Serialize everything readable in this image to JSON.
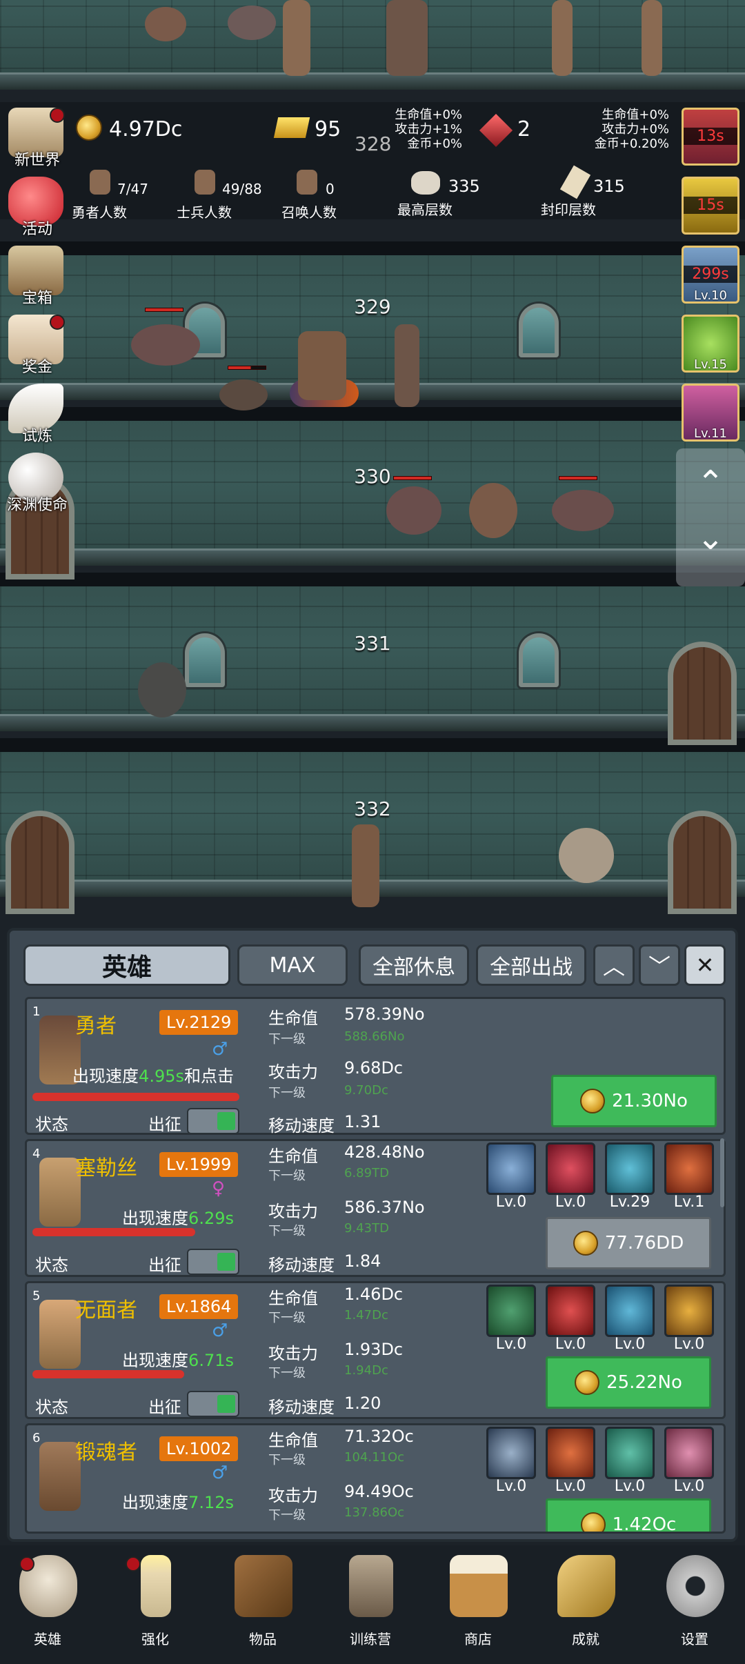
{
  "hud": {
    "gold": "4.97Dc",
    "bars": "95",
    "floor_top": "328",
    "gems": "2",
    "bonus_left": [
      "生命值+0%",
      "攻击力+1%",
      "金币+0%"
    ],
    "bonus_right": [
      "生命值+0%",
      "攻击力+0%",
      "金币+0.20%"
    ],
    "heroes_count": "7/47",
    "heroes_label": "勇者人数",
    "soldiers_count": "49/88",
    "soldiers_label": "士兵人数",
    "summon_count": "0",
    "summon_label": "召唤人数",
    "max_floor": "335",
    "max_floor_label": "最高层数",
    "seal_floor": "315",
    "seal_floor_label": "封印层数"
  },
  "left_menu": [
    "新世界",
    "活动",
    "宝箱",
    "奖金",
    "试炼",
    "深渊使命"
  ],
  "right_slots": [
    {
      "timer": "13s",
      "lv": ""
    },
    {
      "timer": "15s",
      "lv": ""
    },
    {
      "timer": "299s",
      "lv": "Lv.10"
    },
    {
      "timer": "",
      "lv": "Lv.15"
    },
    {
      "timer": "",
      "lv": "Lv.11"
    }
  ],
  "floors": [
    "329",
    "330",
    "331",
    "332"
  ],
  "arrows": {
    "up": "⌃",
    "down": "⌄"
  },
  "toolbar": {
    "heroes_tab": "英雄",
    "max_btn": "MAX",
    "rest_all": "全部休息",
    "deploy_all": "全部出战",
    "up": "︿",
    "down": "﹀",
    "close": "✕"
  },
  "labels": {
    "hp": "生命值",
    "next": "下一级",
    "atk": "攻击力",
    "move": "移动速度",
    "status": "状态",
    "deploy": "出征"
  },
  "heroes": [
    {
      "idx": "1",
      "name": "勇者",
      "lv": "Lv.2129",
      "gender": "♂",
      "speed_pre": "出现速度",
      "speed": "4.95s",
      "speed_post": "和点击",
      "hp": "578.39No",
      "hp_next": "588.66No",
      "atk": "9.68Dc",
      "atk_next": "9.70Dc",
      "move": "1.31",
      "cost": "21.30No",
      "skills": []
    },
    {
      "idx": "4",
      "name": "塞勒丝",
      "lv": "Lv.1999",
      "gender": "♀",
      "speed_pre": "出现速度",
      "speed": "6.29s",
      "speed_post": "",
      "hp": "428.48No",
      "hp_next": "6.89TD",
      "atk": "586.37No",
      "atk_next": "9.43TD",
      "move": "1.84",
      "cost": "77.76DD",
      "skills": [
        "Lv.0",
        "Lv.0",
        "Lv.29",
        "Lv.1"
      ]
    },
    {
      "idx": "5",
      "name": "无面者",
      "lv": "Lv.1864",
      "gender": "♂",
      "speed_pre": "出现速度",
      "speed": "6.71s",
      "speed_post": "",
      "hp": "1.46Dc",
      "hp_next": "1.47Dc",
      "atk": "1.93Dc",
      "atk_next": "1.94Dc",
      "move": "1.20",
      "cost": "25.22No",
      "skills": [
        "Lv.0",
        "Lv.0",
        "Lv.0",
        "Lv.0"
      ]
    },
    {
      "idx": "6",
      "name": "锻魂者",
      "lv": "Lv.1002",
      "gender": "♂",
      "speed_pre": "出现速度",
      "speed": "7.12s",
      "speed_post": "",
      "hp": "71.32Oc",
      "hp_next": "104.11Oc",
      "atk": "94.49Oc",
      "atk_next": "137.86Oc",
      "move": "",
      "cost": "1.42Oc",
      "skills": [
        "Lv.0",
        "Lv.0",
        "Lv.0",
        "Lv.0"
      ]
    }
  ],
  "nav": [
    "英雄",
    "强化",
    "物品",
    "训练营",
    "商店",
    "成就",
    "设置"
  ],
  "colors": {
    "accent_orange": "#e5760e",
    "name_gold": "#f0c000",
    "buy_green": "#3fba5a",
    "speed_green": "#4ee04e"
  }
}
